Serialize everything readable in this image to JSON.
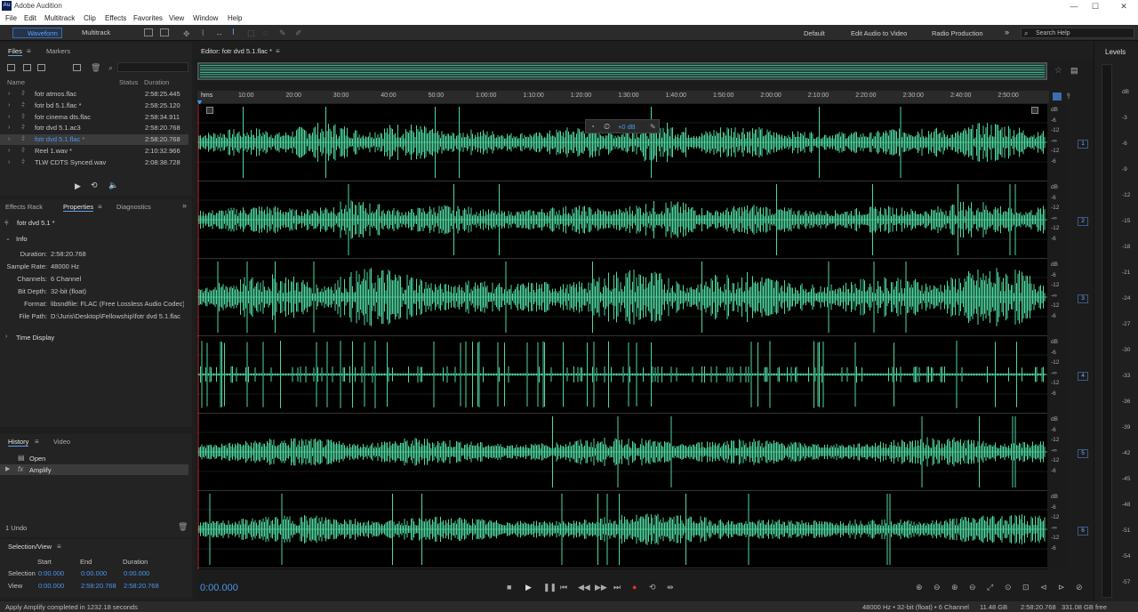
{
  "app": {
    "title": "Adobe Audition",
    "logo": "Au"
  },
  "menu": [
    "File",
    "Edit",
    "Multitrack",
    "Clip",
    "Effects",
    "Favorites",
    "View",
    "Window",
    "Help"
  ],
  "toolbar": {
    "waveform_label": "Waveform",
    "multitrack_label": "Multitrack",
    "workspaces": [
      "Default",
      "Edit Audio to Video",
      "Radio Production"
    ],
    "search_placeholder": "Search Help"
  },
  "files_panel": {
    "tabs": [
      "Files",
      "Markers"
    ],
    "columns": [
      "Name",
      "Status",
      "Duration"
    ],
    "rows": [
      {
        "name": "fotr atmos.flac",
        "duration": "2:58:25.445"
      },
      {
        "name": "fotr bd 5.1.flac *",
        "duration": "2:58:25.120"
      },
      {
        "name": "fotr cinema dts.flac",
        "duration": "2:58:34.911"
      },
      {
        "name": "fotr dvd 5.1.ac3",
        "duration": "2:58:20.768"
      },
      {
        "name": "fotr dvd 5.1.flac *",
        "duration": "2:58:20.768"
      },
      {
        "name": "Reel 1.wav *",
        "duration": "2:10:32.966"
      },
      {
        "name": "TLW CDTS Synced.wav",
        "duration": "2:08:38.728"
      }
    ]
  },
  "properties_panel": {
    "tabs": [
      "Effects Rack",
      "Properties",
      "Diagnostics"
    ],
    "file_title": "fotr dvd 5.1 *",
    "info_label": "Info",
    "info": [
      {
        "k": "Duration:",
        "v": "2:58:20.768"
      },
      {
        "k": "Sample Rate:",
        "v": "48000 Hz"
      },
      {
        "k": "Channels:",
        "v": "6 Channel"
      },
      {
        "k": "Bit Depth:",
        "v": "32-bit (float)"
      },
      {
        "k": "Format:",
        "v": "libsndfile: FLAC (Free Lossless Audio Codec)..."
      },
      {
        "k": "File Path:",
        "v": "D:\\Juris\\Desktop\\Fellowship\\fotr dvd 5.1.flac"
      }
    ],
    "time_display_label": "Time Display"
  },
  "history_panel": {
    "tabs": [
      "History",
      "Video"
    ],
    "items": [
      "Open",
      "Amplify"
    ],
    "undo_count": "1 Undo"
  },
  "selection_panel": {
    "title": "Selection/View",
    "cols": [
      "Start",
      "End",
      "Duration"
    ],
    "selection": {
      "label": "Selection",
      "start": "0:00.000",
      "end": "0:00.000",
      "duration": "0:00.000"
    },
    "view": {
      "label": "View",
      "start": "0:00.000",
      "end": "2:58:20.768",
      "duration": "2:58:20.768"
    }
  },
  "editor": {
    "title": "Editor: fotr dvd 5.1.flac *",
    "hud_gain": "+0 dB",
    "ruler_unit": "hms",
    "ruler_ticks": [
      "10:00",
      "20:00",
      "30:00",
      "40:00",
      "50:00",
      "1:00:00",
      "1:10:00",
      "1:20:00",
      "1:30:00",
      "1:40:00",
      "1:50:00",
      "2:00:00",
      "2:10:00",
      "2:20:00",
      "2:30:00",
      "2:40:00",
      "2:50:00"
    ],
    "db_labels": [
      "dB",
      "-6",
      "-12",
      "-∞",
      "-12",
      "-6"
    ],
    "channels": [
      "1",
      "2",
      "3",
      "4",
      "5",
      "6"
    ],
    "wave_color": "#4fd8a0",
    "current_time": "0:00.000"
  },
  "levels": {
    "title": "Levels",
    "scale": [
      "dB",
      "-3",
      "-6",
      "-9",
      "-12",
      "-15",
      "-18",
      "-21",
      "-24",
      "-27",
      "-30",
      "-33",
      "-36",
      "-39",
      "-42",
      "-45",
      "-48",
      "-51",
      "-54",
      "-57"
    ]
  },
  "status": {
    "message": "Apply Amplify completed in 1232.18 seconds",
    "format": "48000 Hz • 32-bit (float) • 6 Channel",
    "size": "11.48 GB",
    "duration": "2:58:20.768",
    "free": "331.08 GB free"
  }
}
